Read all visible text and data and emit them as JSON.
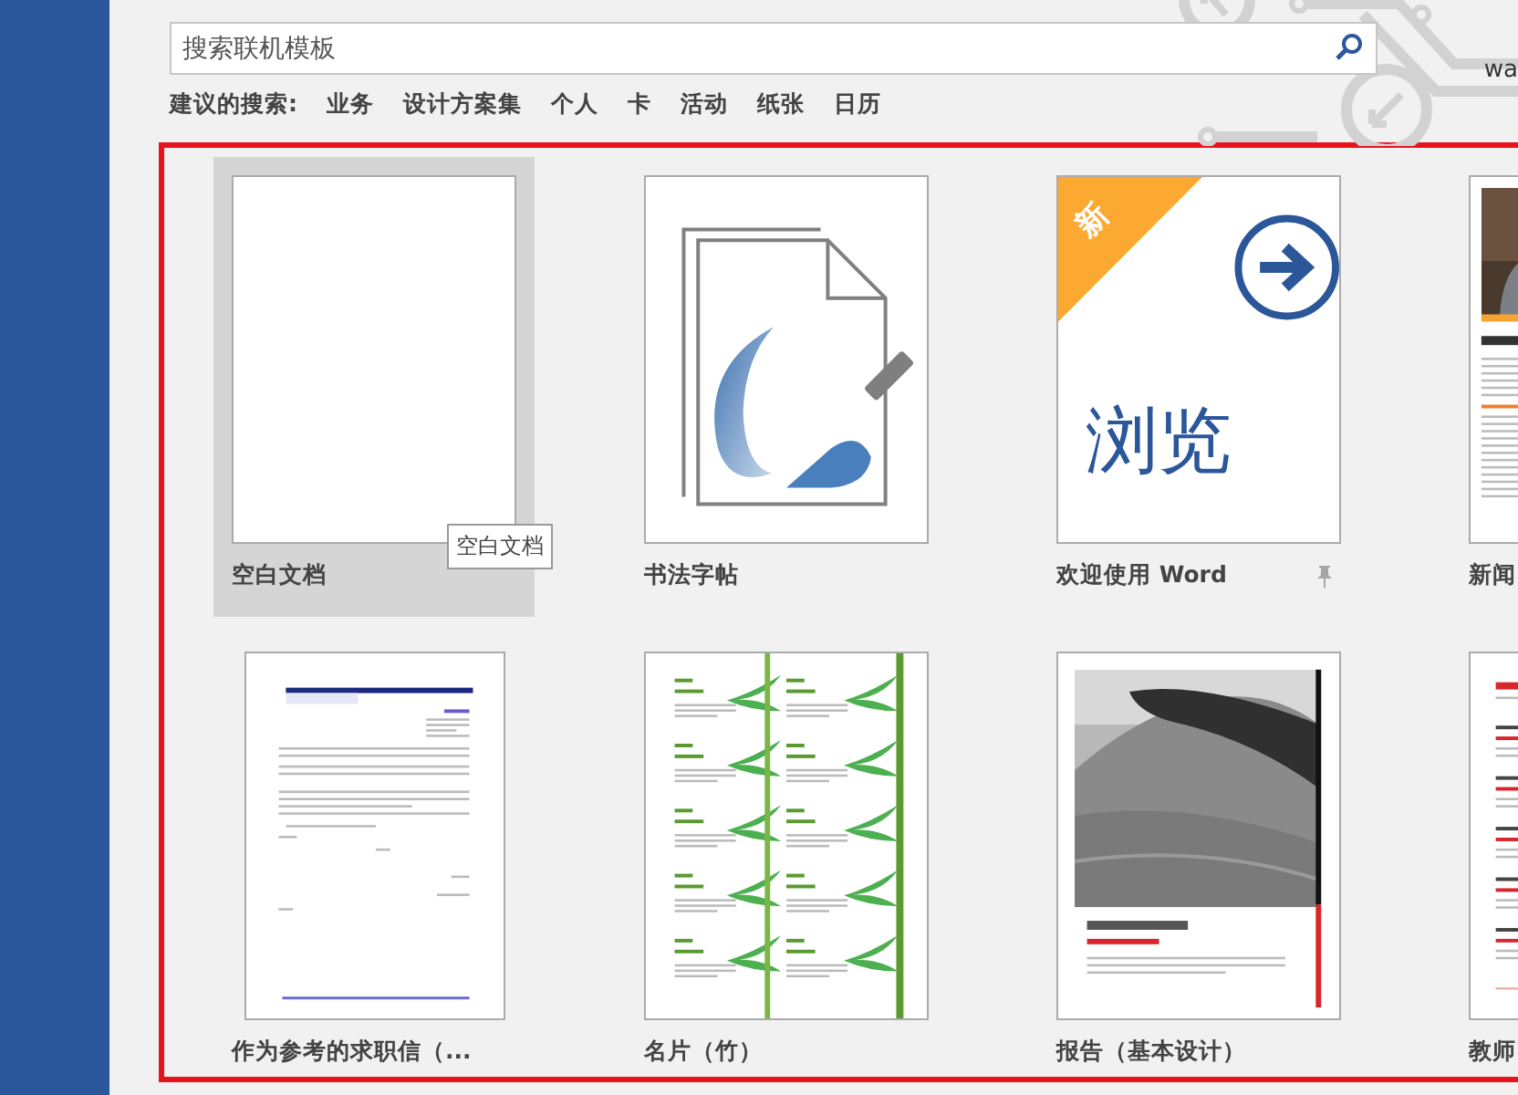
{
  "search": {
    "placeholder": "搜索联机模板"
  },
  "account": {
    "text": "wa"
  },
  "suggestions": {
    "label": "建议的搜索:",
    "items": [
      "业务",
      "设计方案集",
      "个人",
      "卡",
      "活动",
      "纸张",
      "日历"
    ]
  },
  "templates": [
    {
      "kind": "blank",
      "title": "空白文档",
      "selected": true,
      "pin": false,
      "tooltip": "空白文档"
    },
    {
      "kind": "calligraphy",
      "title": "书法字帖",
      "selected": false,
      "pin": false
    },
    {
      "kind": "welcome",
      "title": "欢迎使用 Word",
      "selected": false,
      "pin": true,
      "badge": "新",
      "caption": "浏览"
    },
    {
      "kind": "newsletter",
      "title": "新闻",
      "selected": false,
      "pin": false
    },
    {
      "kind": "letter",
      "title": "作为参考的求职信（...",
      "selected": false,
      "pin": false
    },
    {
      "kind": "bamboo",
      "title": "名片（竹）",
      "selected": false,
      "pin": false
    },
    {
      "kind": "report",
      "title": "报告（基本设计）",
      "selected": false,
      "pin": false
    },
    {
      "kind": "resume",
      "title": "教师",
      "selected": false,
      "pin": false
    }
  ]
}
